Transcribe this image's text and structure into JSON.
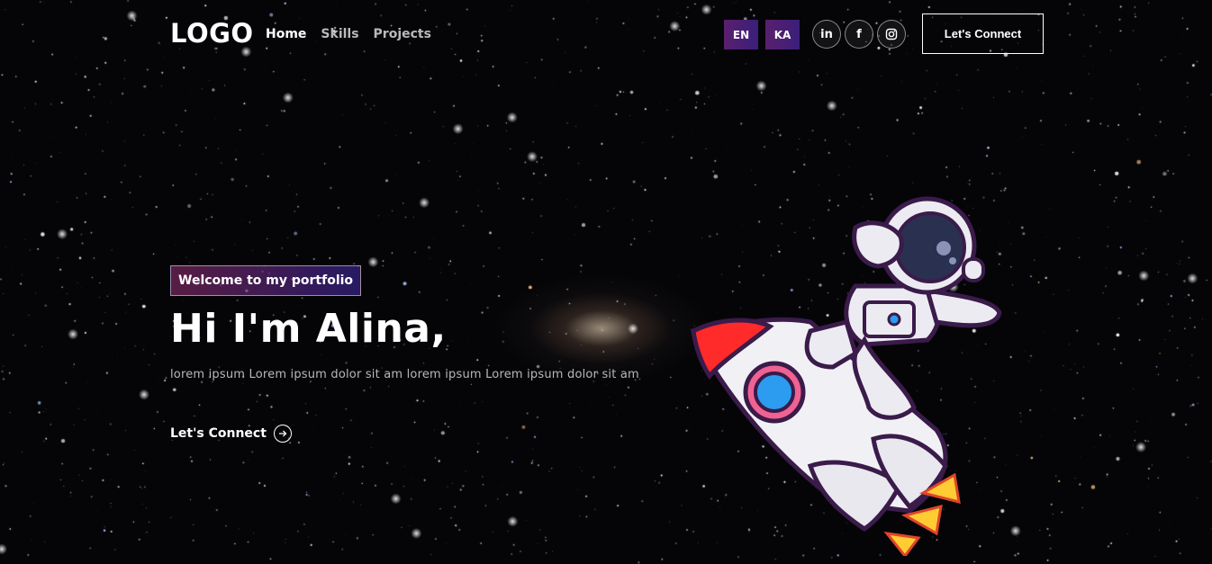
{
  "nav": {
    "logo": "LOGO",
    "links": [
      {
        "label": "Home",
        "active": true
      },
      {
        "label": "Skills",
        "active": false
      },
      {
        "label": "Projects",
        "active": false
      }
    ],
    "languages": [
      "EN",
      "KA"
    ],
    "social": [
      {
        "name": "linkedin-icon",
        "glyph": "in"
      },
      {
        "name": "facebook-icon",
        "glyph": "f"
      },
      {
        "name": "instagram-icon",
        "glyph": "◎"
      }
    ],
    "connect_label": "Let's Connect"
  },
  "hero": {
    "tagline": "Welcome to my portfolio",
    "title": "Hi I'm Alina,",
    "description": "lorem ipsum Lorem ipsum dolor sit am lorem ipsum Lorem ipsum dolor sit am",
    "cta_label": "Let's Connect",
    "cta_icon": "arrow-right-circle-icon"
  },
  "colors": {
    "background": "#050508",
    "accent_start": "#aa367c",
    "accent_end": "#4a2fbd",
    "text": "#ffffff",
    "muted": "#b8b8b8"
  }
}
